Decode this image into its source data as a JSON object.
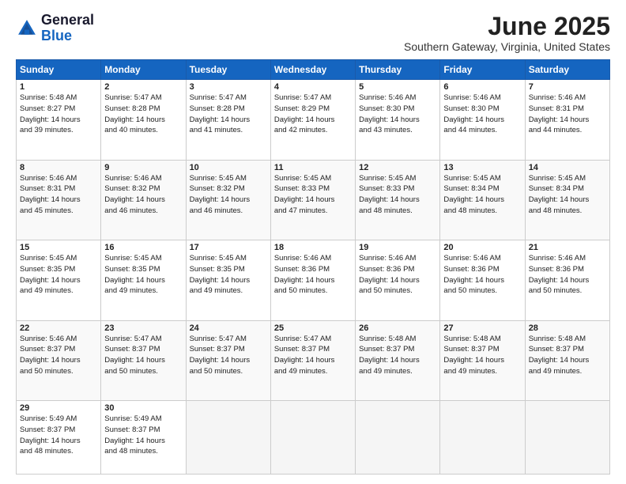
{
  "header": {
    "logo_line1": "General",
    "logo_line2": "Blue",
    "title": "June 2025",
    "subtitle": "Southern Gateway, Virginia, United States"
  },
  "columns": [
    "Sunday",
    "Monday",
    "Tuesday",
    "Wednesday",
    "Thursday",
    "Friday",
    "Saturday"
  ],
  "weeks": [
    [
      {
        "day": "1",
        "info": "Sunrise: 5:48 AM\nSunset: 8:27 PM\nDaylight: 14 hours\nand 39 minutes."
      },
      {
        "day": "2",
        "info": "Sunrise: 5:47 AM\nSunset: 8:28 PM\nDaylight: 14 hours\nand 40 minutes."
      },
      {
        "day": "3",
        "info": "Sunrise: 5:47 AM\nSunset: 8:28 PM\nDaylight: 14 hours\nand 41 minutes."
      },
      {
        "day": "4",
        "info": "Sunrise: 5:47 AM\nSunset: 8:29 PM\nDaylight: 14 hours\nand 42 minutes."
      },
      {
        "day": "5",
        "info": "Sunrise: 5:46 AM\nSunset: 8:30 PM\nDaylight: 14 hours\nand 43 minutes."
      },
      {
        "day": "6",
        "info": "Sunrise: 5:46 AM\nSunset: 8:30 PM\nDaylight: 14 hours\nand 44 minutes."
      },
      {
        "day": "7",
        "info": "Sunrise: 5:46 AM\nSunset: 8:31 PM\nDaylight: 14 hours\nand 44 minutes."
      }
    ],
    [
      {
        "day": "8",
        "info": "Sunrise: 5:46 AM\nSunset: 8:31 PM\nDaylight: 14 hours\nand 45 minutes."
      },
      {
        "day": "9",
        "info": "Sunrise: 5:46 AM\nSunset: 8:32 PM\nDaylight: 14 hours\nand 46 minutes."
      },
      {
        "day": "10",
        "info": "Sunrise: 5:45 AM\nSunset: 8:32 PM\nDaylight: 14 hours\nand 46 minutes."
      },
      {
        "day": "11",
        "info": "Sunrise: 5:45 AM\nSunset: 8:33 PM\nDaylight: 14 hours\nand 47 minutes."
      },
      {
        "day": "12",
        "info": "Sunrise: 5:45 AM\nSunset: 8:33 PM\nDaylight: 14 hours\nand 48 minutes."
      },
      {
        "day": "13",
        "info": "Sunrise: 5:45 AM\nSunset: 8:34 PM\nDaylight: 14 hours\nand 48 minutes."
      },
      {
        "day": "14",
        "info": "Sunrise: 5:45 AM\nSunset: 8:34 PM\nDaylight: 14 hours\nand 48 minutes."
      }
    ],
    [
      {
        "day": "15",
        "info": "Sunrise: 5:45 AM\nSunset: 8:35 PM\nDaylight: 14 hours\nand 49 minutes."
      },
      {
        "day": "16",
        "info": "Sunrise: 5:45 AM\nSunset: 8:35 PM\nDaylight: 14 hours\nand 49 minutes."
      },
      {
        "day": "17",
        "info": "Sunrise: 5:45 AM\nSunset: 8:35 PM\nDaylight: 14 hours\nand 49 minutes."
      },
      {
        "day": "18",
        "info": "Sunrise: 5:46 AM\nSunset: 8:36 PM\nDaylight: 14 hours\nand 50 minutes."
      },
      {
        "day": "19",
        "info": "Sunrise: 5:46 AM\nSunset: 8:36 PM\nDaylight: 14 hours\nand 50 minutes."
      },
      {
        "day": "20",
        "info": "Sunrise: 5:46 AM\nSunset: 8:36 PM\nDaylight: 14 hours\nand 50 minutes."
      },
      {
        "day": "21",
        "info": "Sunrise: 5:46 AM\nSunset: 8:36 PM\nDaylight: 14 hours\nand 50 minutes."
      }
    ],
    [
      {
        "day": "22",
        "info": "Sunrise: 5:46 AM\nSunset: 8:37 PM\nDaylight: 14 hours\nand 50 minutes."
      },
      {
        "day": "23",
        "info": "Sunrise: 5:47 AM\nSunset: 8:37 PM\nDaylight: 14 hours\nand 50 minutes."
      },
      {
        "day": "24",
        "info": "Sunrise: 5:47 AM\nSunset: 8:37 PM\nDaylight: 14 hours\nand 50 minutes."
      },
      {
        "day": "25",
        "info": "Sunrise: 5:47 AM\nSunset: 8:37 PM\nDaylight: 14 hours\nand 49 minutes."
      },
      {
        "day": "26",
        "info": "Sunrise: 5:48 AM\nSunset: 8:37 PM\nDaylight: 14 hours\nand 49 minutes."
      },
      {
        "day": "27",
        "info": "Sunrise: 5:48 AM\nSunset: 8:37 PM\nDaylight: 14 hours\nand 49 minutes."
      },
      {
        "day": "28",
        "info": "Sunrise: 5:48 AM\nSunset: 8:37 PM\nDaylight: 14 hours\nand 49 minutes."
      }
    ],
    [
      {
        "day": "29",
        "info": "Sunrise: 5:49 AM\nSunset: 8:37 PM\nDaylight: 14 hours\nand 48 minutes."
      },
      {
        "day": "30",
        "info": "Sunrise: 5:49 AM\nSunset: 8:37 PM\nDaylight: 14 hours\nand 48 minutes."
      },
      {
        "day": "",
        "info": ""
      },
      {
        "day": "",
        "info": ""
      },
      {
        "day": "",
        "info": ""
      },
      {
        "day": "",
        "info": ""
      },
      {
        "day": "",
        "info": ""
      }
    ]
  ]
}
